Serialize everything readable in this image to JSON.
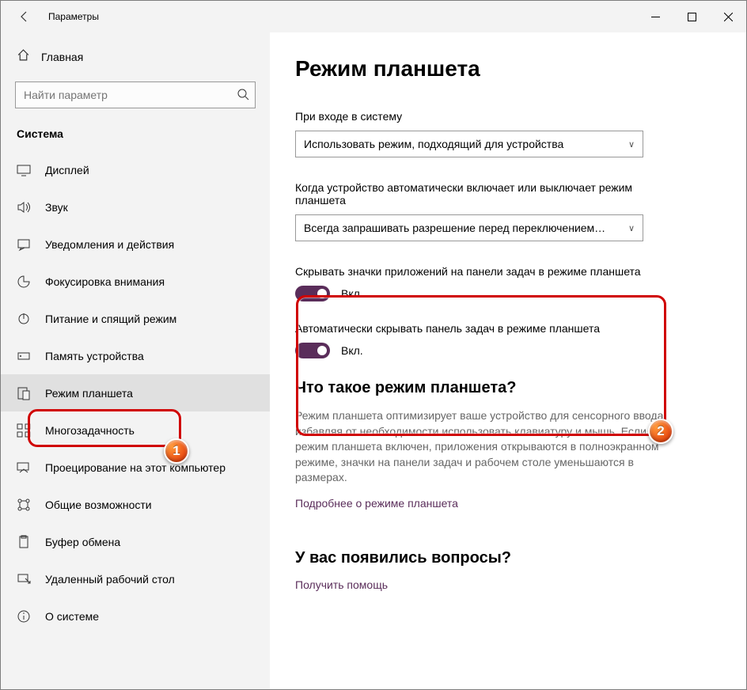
{
  "titlebar": {
    "title": "Параметры"
  },
  "sidebar": {
    "home": "Главная",
    "search_placeholder": "Найти параметр",
    "category": "Система",
    "items": [
      {
        "label": "Дисплей"
      },
      {
        "label": "Звук"
      },
      {
        "label": "Уведомления и действия"
      },
      {
        "label": "Фокусировка внимания"
      },
      {
        "label": "Питание и спящий режим"
      },
      {
        "label": "Память устройства"
      },
      {
        "label": "Режим планшета"
      },
      {
        "label": "Многозадачность"
      },
      {
        "label": "Проецирование на этот компьютер"
      },
      {
        "label": "Общие возможности"
      },
      {
        "label": "Буфер обмена"
      },
      {
        "label": "Удаленный рабочий стол"
      },
      {
        "label": "О системе"
      }
    ]
  },
  "content": {
    "heading": "Режим планшета",
    "section1_label": "При входе в систему",
    "dropdown1": "Использовать режим, подходящий для устройства",
    "section2_label": "Когда устройство автоматически включает или выключает режим планшета",
    "dropdown2": "Всегда запрашивать разрешение перед переключением…",
    "toggle1_label": "Скрывать значки приложений на панели задач в режиме планшета",
    "toggle1_state": "Вкл.",
    "toggle2_label": "Автоматически скрывать панель задач в режиме планшета",
    "toggle2_state": "Вкл.",
    "about_heading": "Что такое режим планшета?",
    "about_desc": "Режим планшета оптимизирует ваше устройство для сенсорного ввода, избавляя от необходимости использовать клавиатуру и мышь. Если режим планшета включен, приложения открываются в полноэкранном режиме, значки на панели задач и рабочем столе уменьшаются в размерах.",
    "about_link": "Подробнее о режиме планшета",
    "help_heading": "У вас появились вопросы?",
    "help_link": "Получить помощь"
  },
  "badges": {
    "b1": "1",
    "b2": "2"
  }
}
